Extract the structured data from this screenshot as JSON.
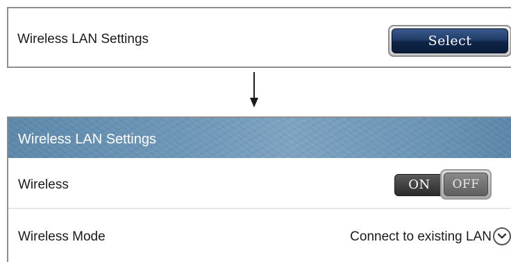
{
  "top_panel": {
    "title": "Wireless LAN Settings",
    "select_label": "Select"
  },
  "settings_panel": {
    "header_title": "Wireless LAN Settings",
    "rows": [
      {
        "label": "Wireless",
        "toggle": {
          "on_label": "ON",
          "off_label": "OFF",
          "state": "OFF"
        }
      },
      {
        "label": "Wireless Mode",
        "value": "Connect to existing LAN",
        "icon": "chevron-down-circle-icon"
      }
    ]
  },
  "colors": {
    "header_blue": "#6f97b8",
    "select_button_navy": "#1a345e",
    "toggle_dark": "#2b2b2b"
  }
}
